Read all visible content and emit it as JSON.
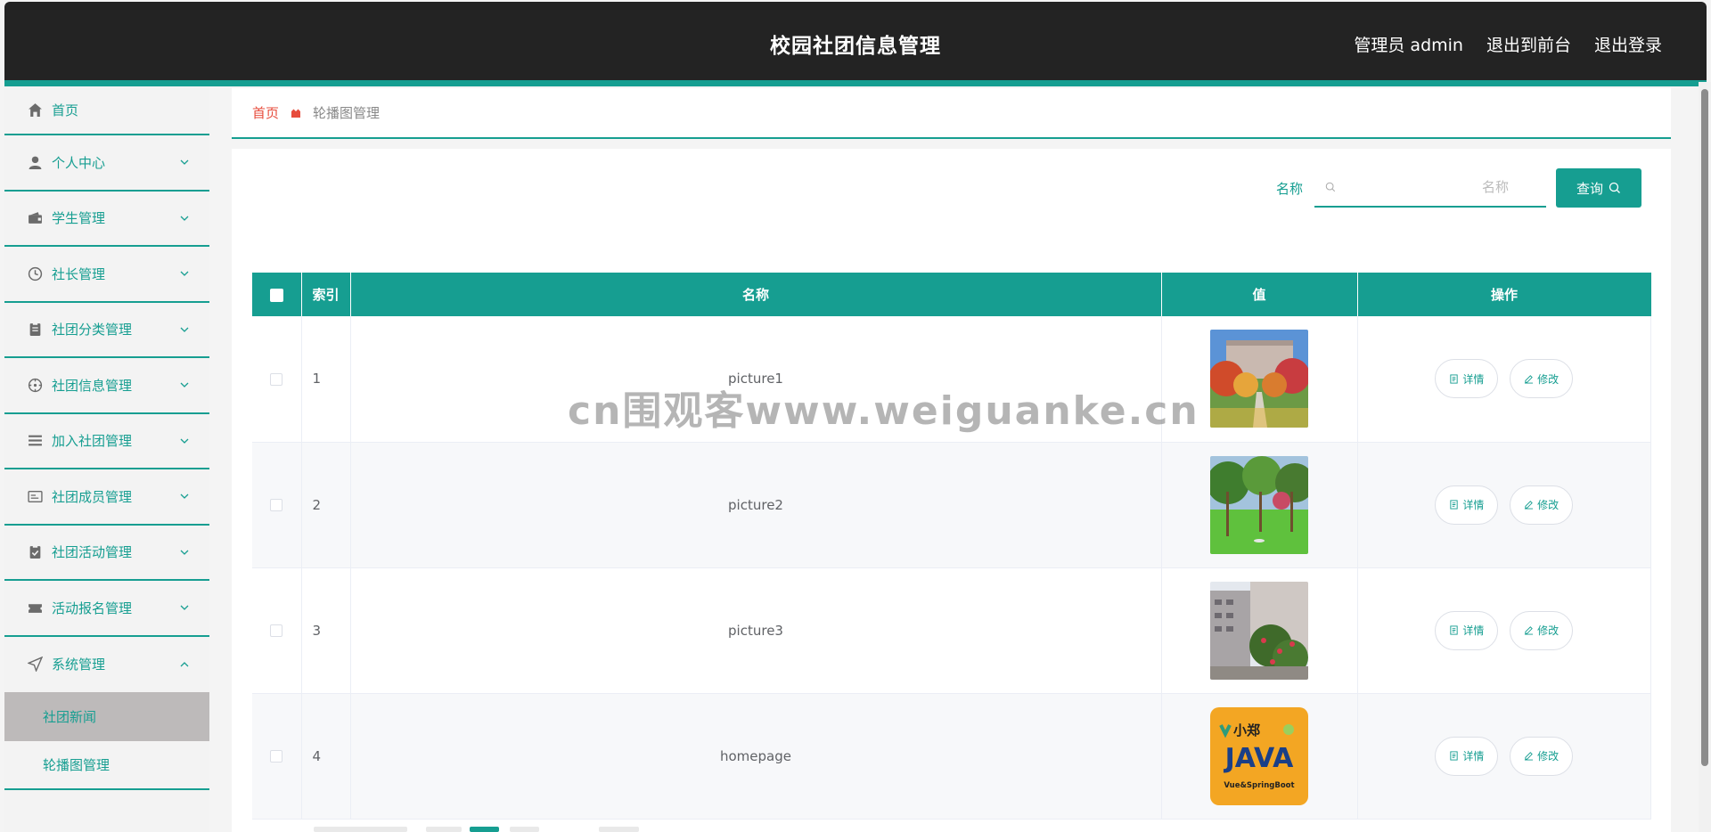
{
  "header": {
    "title": "校园社团信息管理",
    "user": "管理员 admin",
    "to_front": "退出到前台",
    "logout": "退出登录"
  },
  "sidebar": {
    "items": [
      {
        "label": "首页",
        "icon": "home-icon"
      },
      {
        "label": "个人中心",
        "icon": "user-icon"
      },
      {
        "label": "学生管理",
        "icon": "wallet-icon"
      },
      {
        "label": "社长管理",
        "icon": "clock-icon"
      },
      {
        "label": "社团分类管理",
        "icon": "clipboard-icon"
      },
      {
        "label": "社团信息管理",
        "icon": "compass-icon"
      },
      {
        "label": "加入社团管理",
        "icon": "list-icon"
      },
      {
        "label": "社团成员管理",
        "icon": "card-icon"
      },
      {
        "label": "社团活动管理",
        "icon": "check-clipboard-icon"
      },
      {
        "label": "活动报名管理",
        "icon": "ticket-icon"
      },
      {
        "label": "系统管理",
        "icon": "send-icon"
      }
    ],
    "sub_items": [
      {
        "label": "社团新闻"
      },
      {
        "label": "轮播图管理"
      }
    ]
  },
  "breadcrumb": {
    "home": "首页",
    "current": "轮播图管理"
  },
  "search": {
    "label": "名称",
    "placeholder": "名称",
    "button": "查询"
  },
  "table": {
    "headers": [
      "索引",
      "名称",
      "值",
      "操作"
    ],
    "rows": [
      {
        "index": "1",
        "name": "picture1"
      },
      {
        "index": "2",
        "name": "picture2"
      },
      {
        "index": "3",
        "name": "picture3"
      },
      {
        "index": "4",
        "name": "homepage"
      }
    ],
    "detail_label": "详情",
    "edit_label": "修改"
  },
  "thumb4": {
    "brand": "小郑",
    "title": "JAVA",
    "subtitle": "Vue&SpringBoot"
  },
  "watermark": "cn围观客www.weiguanke.cn",
  "colors": {
    "accent": "#169e91",
    "header_bg": "#232323",
    "breadcrumb_home": "#e74c3c"
  }
}
